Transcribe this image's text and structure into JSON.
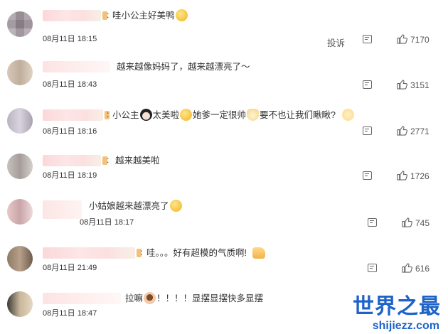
{
  "comments": [
    {
      "text": "哇小公主好美鸭",
      "time": "08月11日 18:15",
      "report": "投诉",
      "likes": "7170",
      "emojis": [
        "grin-face-icon"
      ]
    },
    {
      "text": "越来越像妈妈了，越来越漂亮了～",
      "time": "08月11日 18:43",
      "likes": "3151"
    },
    {
      "text_parts": [
        "小公主",
        "太美啦",
        "她爹一定很帅",
        "要不也让我们瞅瞅?"
      ],
      "time": "08月11日 18:16",
      "likes": "2771",
      "emojis": [
        "girl-icon",
        "grin-face-icon",
        "cat-face-icon",
        "peace-hand-icon"
      ]
    },
    {
      "text": "越来越美啦",
      "time": "08月11日 18:19",
      "likes": "1726"
    },
    {
      "text": "小姑娘越来越漂亮了",
      "time": "08月11日 18:17",
      "likes": "745",
      "emojis": [
        "grin-face-icon"
      ]
    },
    {
      "text_parts": [
        "哇。。。好有超模的气质啊!"
      ],
      "time": "08月11日 21:49",
      "likes": "616",
      "emojis": [
        "thumbs-up-icon"
      ]
    },
    {
      "text_parts": [
        "拉嘛",
        "！！！！显摆显摆快多显摆"
      ],
      "time": "08月11日 18:47",
      "emojis": [
        "face-icon"
      ]
    }
  ],
  "watermark": {
    "logo": "世界之最",
    "url": "shijiezz.com"
  },
  "colors": {
    "text": "#333333",
    "muted": "#555555",
    "name_blur": "#fbd8da",
    "watermark": "#1e63c8"
  }
}
